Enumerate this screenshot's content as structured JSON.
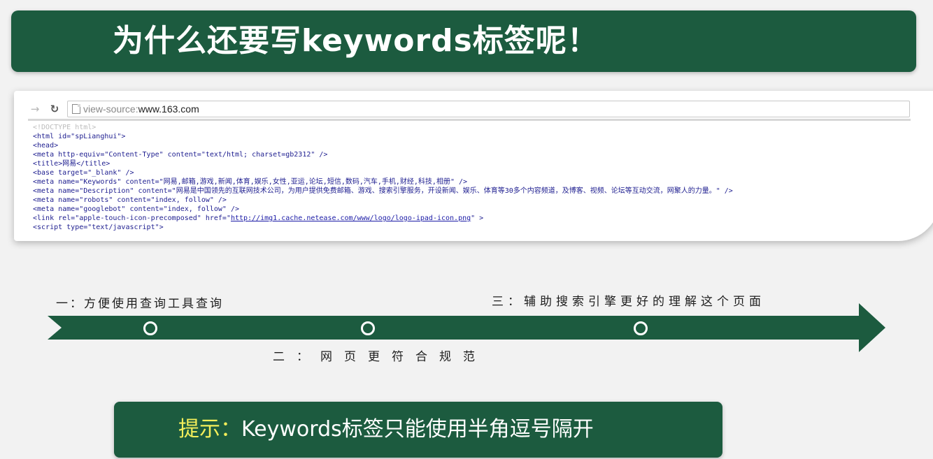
{
  "slide": {
    "title": "为什么还要写keywords标签呢！"
  },
  "browser": {
    "back_icon": "back-arrow-icon",
    "reload_icon": "reload-icon",
    "address": {
      "scheme": "view-source:",
      "host": "www.163.com"
    },
    "source_lines": [
      "<!DOCTYPE html>",
      "<html id=\"spLianghui\">",
      "<head>",
      "<meta http-equiv=\"Content-Type\" content=\"text/html; charset=gb2312\" />",
      "<title>网易</title>",
      "<base target=\"_blank\" />",
      "<meta name=\"Keywords\" content=\"网易,邮箱,游戏,新闻,体育,娱乐,女性,亚运,论坛,短信,数码,汽车,手机,财经,科技,相册\" />",
      "<meta name=\"Description\" content=\"网易是中国领先的互联网技术公司，为用户提供免费邮箱、游戏、搜索引擎服务，开设新闻、娱乐、体育等30多个内容频道，及博客、视频、论坛等互动交流，网聚人的力量。\" />",
      "<meta name=\"robots\" content=\"index, follow\" />",
      "<meta name=\"googlebot\" content=\"index, follow\" />"
    ],
    "link_line": {
      "before": "<link rel=\"apple-touch-icon-precomposed\" href=\"",
      "url": "http://img1.cache.netease.com/www/logo/logo-ipad-icon.png",
      "after": "\" >"
    },
    "script_line": "<script type=\"text/javascript\">"
  },
  "timeline": {
    "item1": "一：方便使用查询工具查询",
    "item2": "二：网页更符合规范",
    "item3": "三：辅助搜索引擎更好的理解这个页面"
  },
  "tip": {
    "prefix": "提示：",
    "body": "Keywords标签只能使用半角逗号隔开"
  },
  "colors": {
    "primary_green": "#1c5b3f",
    "tip_highlight": "#f3ee5a",
    "panel_accent": "#4f8a3a"
  }
}
